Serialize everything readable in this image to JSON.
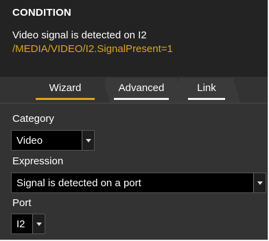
{
  "condition": {
    "title": "CONDITION",
    "description": "Video signal is detected on I2",
    "path": "/MEDIA/VIDEO/I2.SignalPresent=1"
  },
  "tabs": [
    {
      "label": "Wizard",
      "active": true
    },
    {
      "label": "Advanced",
      "active": false
    },
    {
      "label": "Link",
      "active": false
    }
  ],
  "fields": {
    "category": {
      "label": "Category",
      "value": "Video"
    },
    "expression": {
      "label": "Expression",
      "value": "Signal is detected on a port"
    },
    "port": {
      "label": "Port",
      "value": "I2"
    }
  },
  "colors": {
    "accent": "#d9a51f",
    "panel": "#333333",
    "header": "#232323"
  }
}
